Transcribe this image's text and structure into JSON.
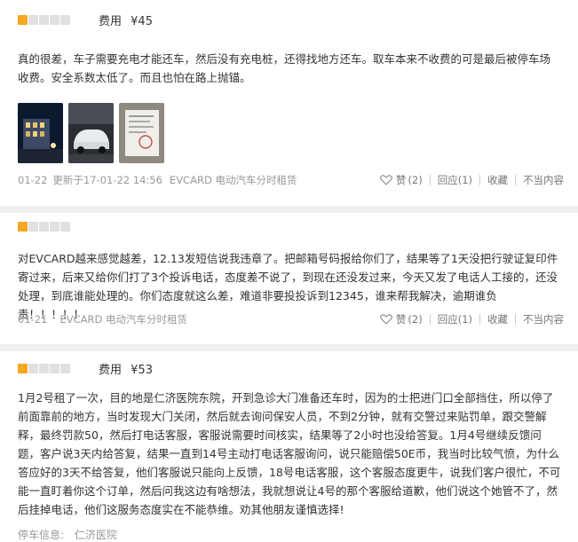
{
  "reviews": [
    {
      "stars": 1,
      "fee_label": "费用",
      "fee_value": "¥45",
      "text": "真的很差，车子需要充电才能还车，然后没有充电桩，还得找地方还车。取车本来不收费的可是最后被停车场收费。安全系数太低了。而且也怕在路上抛锚。",
      "date": "01-22",
      "updated": "更新于17-01-22 14:56",
      "source": "EVCARD 电动汽车分时租赁",
      "like_label": "赞",
      "like_count": "(2)",
      "reply_label": "回应",
      "reply_count": "(1)",
      "collect_label": "收藏",
      "report_label": "不当内容"
    },
    {
      "stars": 1,
      "text": "对EVCARD越来感觉越差，12.13发短信说我违章了。把邮箱号码报给你们了，结果等了1天没把行驶证复印件寄过来，后来又给你们打了3个投诉电话，态度差不说了，到现在还没发过来，今天又发了电话人工接的，还没处理，到底谁能处理的。你们态度就这么差，难道非要投投诉到12345，谁来帮我解决，逾期谁负责！！！！！",
      "date": "01-21",
      "source": "EVCARD 电动汽车分时租赁",
      "like_label": "赞",
      "like_count": "(2)",
      "reply_label": "回应",
      "reply_count": "(1)",
      "collect_label": "收藏",
      "report_label": "不当内容"
    },
    {
      "stars": 1,
      "fee_label": "费用",
      "fee_value": "¥53",
      "text": "1月2号租了一次，目的地是仁济医院东院，开到急诊大门准备还车时，因为的士把进门口全部挡住，所以停了前面靠前的地方，当时发现大门关闭，然后就去询问保安人员，不到2分钟，就有交警过来贴罚单，跟交警解释，最终罚款50，然后打电话客服，客服说需要时间核实，结果等了2小时也没给答复。1月4号继续反馈问题，客户说3天内给答复，结果一直到14号主动打电话客服询问，说只能赔偿50E币，我当时比较气愤，为什么答应好的3天不给答复，他们客服说只能向上反馈，18号电话客服，这个客服态度更牛，说我们客户很忙，不可能一直盯着你这个订单，然后问我这边有啥想法，我就想说让4号的那个客服给道歉，他们说这个她管不了，然后挂掉电话，他们这服务态度实在不能恭维。劝其他朋友谨慎选择!",
      "footer_label": "停车信息:",
      "footer_value": "仁济医院"
    }
  ],
  "photos": [
    "night-building-photo",
    "white-car-photo",
    "parking-ticket-photo"
  ],
  "colors": {
    "star_on": "#f5a623",
    "star_off": "#e0e0e0",
    "text": "#333333",
    "meta": "#999999",
    "band": "#f0f0f0"
  }
}
